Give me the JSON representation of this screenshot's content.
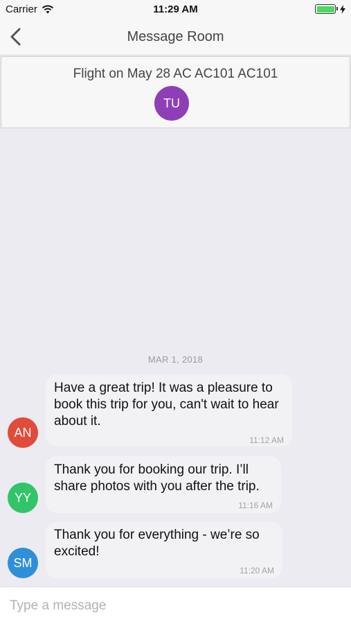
{
  "status_bar": {
    "carrier": "Carrier",
    "time": "11:29 AM",
    "icons": [
      "wifi-icon",
      "battery-icon",
      "charging-bolt-icon"
    ],
    "battery_color": "#4cd964"
  },
  "nav": {
    "title": "Message Room",
    "back_icon": "chevron-left-icon"
  },
  "trip": {
    "title": "Flight on May 28 AC AC101 AC101",
    "avatar_initials": "TU",
    "avatar_color": "#8e3fb8"
  },
  "date_divider": "MAR 1, 2018",
  "messages": [
    {
      "initials": "AN",
      "avatar_color": "#e04b3a",
      "text": "Have a great trip! It was a pleasure to book this trip for you, can't wait to hear about it.",
      "time": "11:12 AM"
    },
    {
      "initials": "YY",
      "avatar_color": "#33c46a",
      "text": "Thank you for booking our trip. I’ll share photos with you after the trip.",
      "time": "11:16 AM"
    },
    {
      "initials": "SM",
      "avatar_color": "#2f8fd8",
      "text": "Thank you for everything - we’re so excited!",
      "time": "11:20 AM"
    }
  ],
  "composer": {
    "placeholder": "Type a message",
    "value": ""
  }
}
